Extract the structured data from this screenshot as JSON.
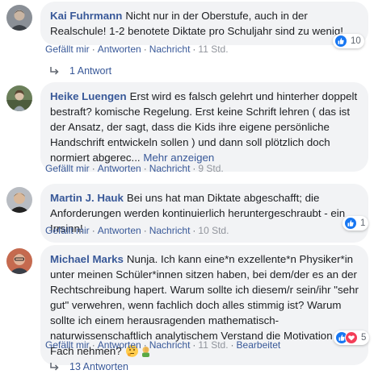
{
  "actions": {
    "like": "Gefällt mir",
    "reply": "Antworten",
    "message": "Nachricht",
    "sep": "·"
  },
  "comments": [
    {
      "author": "Kai Fuhrmann",
      "text": "Nicht nur in der Oberstufe, auch in der Realschule! 1-2 benotete Diktate pro Schuljahr sind zu wenig!",
      "time": "11 Std.",
      "reaction_count": "10",
      "reaction_icons": [
        "like-icon"
      ],
      "reply_label": "1 Antwort"
    },
    {
      "author": "Heike Luengen",
      "text": "Erst wird es falsch gelehrt und hinterher doppelt bestraft? komische Regelung. Erst keine Schrift lehren ( das ist der Ansatz, der sagt, dass die Kids ihre eigene persönliche Handschrift entwickeln sollen ) und dann soll plötzlich doch normiert abgerec...",
      "more": "Mehr anzeigen",
      "time": "9 Std."
    },
    {
      "author": "Martin J. Hauk",
      "text": "Bei uns hat man Diktate abgeschafft; die Anforderungen werden kontinuierlich heruntergeschraubt - ein Irrsinn!",
      "time": "10 Std.",
      "reaction_count": "1",
      "reaction_icons": [
        "like-icon"
      ]
    },
    {
      "author": "Michael Marks",
      "text": "Nunja. Ich kann eine*n exzellente*n Physiker*in unter meinen Schüler*innen sitzen haben, bei dem/der es an der Rechtschreibung hapert. Warum sollte ich diesem/r sein/ihr \"sehr gut\" verwehren, wenn fachlich doch alles stimmig ist? Warum sollte ich einem herausragenden mathematisch-naturwissenschaftlich analytischem Verstand die Motivation für's Fach nehmen?",
      "text_emojis": [
        "thinking-face-emoji",
        "person-facepalming-emoji"
      ],
      "time": "11 Std.",
      "edited": "Bearbeitet",
      "reaction_count": "5",
      "reaction_icons": [
        "like-icon",
        "love-icon"
      ],
      "reply_label": "13 Antworten"
    }
  ],
  "colors": {
    "link": "#385898",
    "bubble": "#f2f3f5",
    "like": "#1877f2",
    "love": "#f33e58"
  }
}
